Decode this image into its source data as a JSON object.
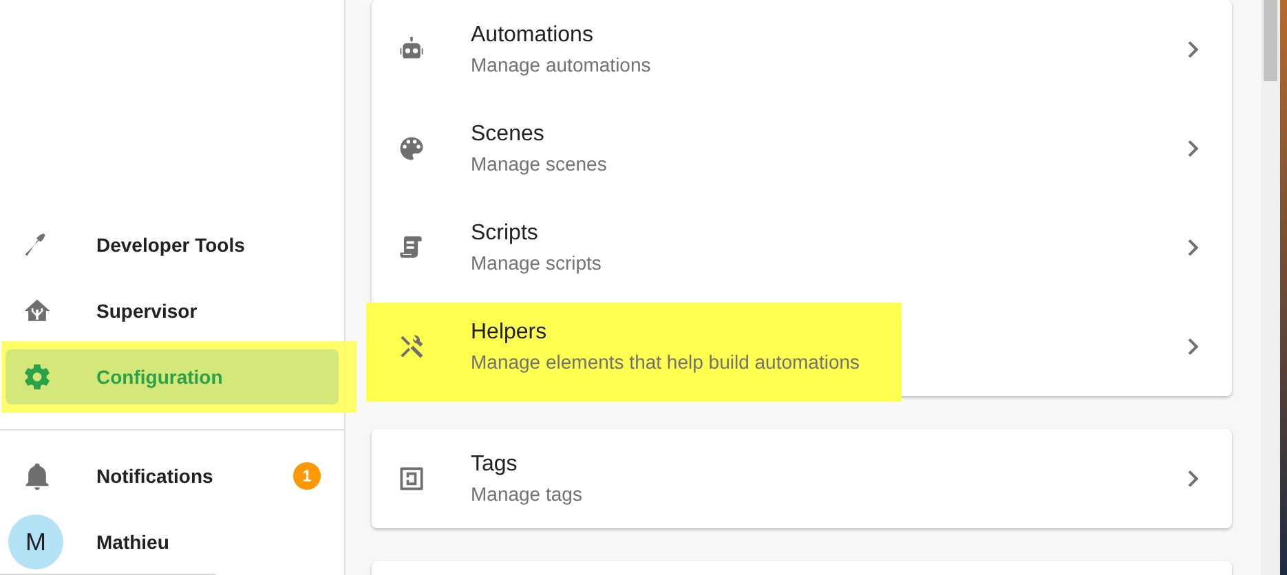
{
  "sidebar": {
    "items": [
      {
        "label": "Developer Tools",
        "selected": false,
        "highlighted": false
      },
      {
        "label": "Supervisor",
        "selected": false,
        "highlighted": false
      },
      {
        "label": "Configuration",
        "selected": true,
        "highlighted": true
      }
    ],
    "notifications": {
      "label": "Notifications",
      "badge": "1"
    },
    "user": {
      "initial": "M",
      "name": "Mathieu"
    }
  },
  "cards": [
    {
      "rows": [
        {
          "title": "Automations",
          "subtitle": "Manage automations",
          "highlighted": false
        },
        {
          "title": "Scenes",
          "subtitle": "Manage scenes",
          "highlighted": false
        },
        {
          "title": "Scripts",
          "subtitle": "Manage scripts",
          "highlighted": false
        },
        {
          "title": "Helpers",
          "subtitle": "Manage elements that help build automations",
          "highlighted": true
        }
      ]
    },
    {
      "rows": [
        {
          "title": "Tags",
          "subtitle": "Manage tags",
          "highlighted": false
        }
      ]
    }
  ]
}
